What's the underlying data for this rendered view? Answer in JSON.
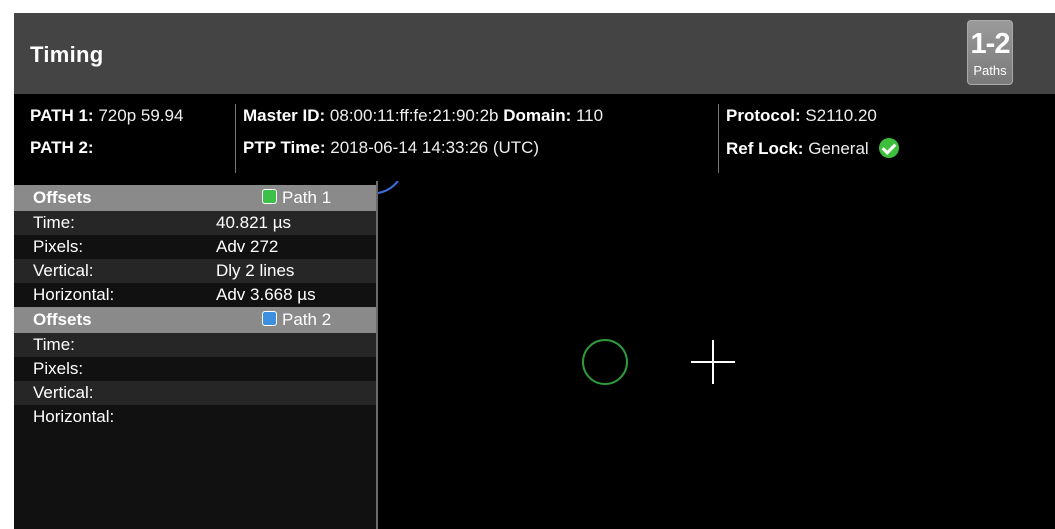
{
  "header": {
    "title": "Timing",
    "paths_button": {
      "number": "1-2",
      "label": "Paths"
    }
  },
  "info": {
    "path1": {
      "label": "PATH 1:",
      "value": "720p 59.94"
    },
    "path2": {
      "label": "PATH 2:",
      "value": ""
    },
    "master_id": {
      "label": "Master ID:",
      "value": "08:00:11:ff:fe:21:90:2b"
    },
    "domain": {
      "label": "Domain:",
      "value": "110"
    },
    "ptp_time": {
      "label": "PTP Time:",
      "value": "2018-06-14 14:33:26 (UTC)"
    },
    "protocol": {
      "label": "Protocol:",
      "value": "S2110.20"
    },
    "ref_lock": {
      "label": "Ref Lock:",
      "value": "General",
      "status_icon": "check-circle-icon"
    }
  },
  "offsets": [
    {
      "title": "Offsets",
      "path_label": "Path 1",
      "color": "#3cc04a",
      "rows": [
        {
          "label": "Time:",
          "value": "40.821 µs"
        },
        {
          "label": "Pixels:",
          "value": "Adv 272"
        },
        {
          "label": "Vertical:",
          "value": "Dly 2 lines"
        },
        {
          "label": "Horizontal:",
          "value": "Adv 3.668 µs"
        }
      ]
    },
    {
      "title": "Offsets",
      "path_label": "Path 2",
      "color": "#3d8fe0",
      "rows": [
        {
          "label": "Time:",
          "value": ""
        },
        {
          "label": "Pixels:",
          "value": ""
        },
        {
          "label": "Vertical:",
          "value": ""
        },
        {
          "label": "Horizontal:",
          "value": ""
        }
      ]
    }
  ],
  "graph": {
    "marker_colors": {
      "path1": "#2f9a3a",
      "crosshair": "#ffffff",
      "arc": "#3d6fe0"
    }
  }
}
